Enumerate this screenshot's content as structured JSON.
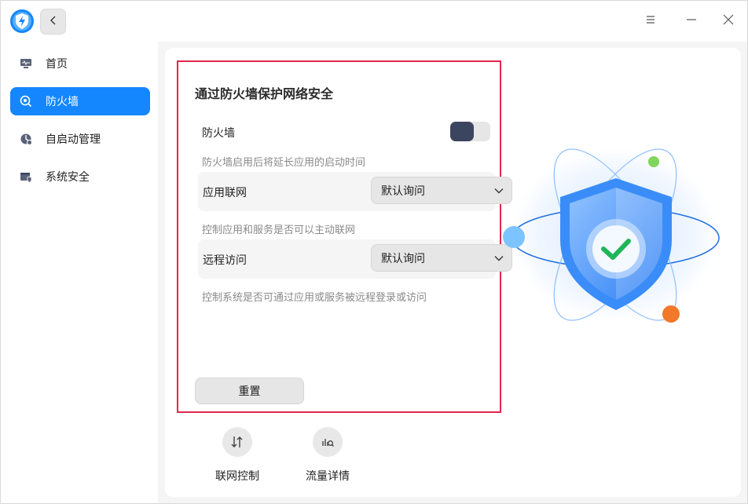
{
  "titlebar": {
    "logo_icon": "shield-lightning-icon",
    "back_icon": "chevron-left-icon",
    "menu_icon": "menu-icon",
    "minimize_icon": "minimize-icon",
    "close_icon": "close-icon"
  },
  "sidebar": {
    "items": [
      {
        "label": "首页",
        "icon": "monitor-icon",
        "active": false
      },
      {
        "label": "防火墙",
        "icon": "firewall-icon",
        "active": true
      },
      {
        "label": "自启动管理",
        "icon": "startup-icon",
        "active": false
      },
      {
        "label": "系统安全",
        "icon": "system-security-icon",
        "active": false
      }
    ]
  },
  "panel": {
    "title": "通过防火墙保护网络安全",
    "firewall_label": "防火墙",
    "firewall_enabled": false,
    "firewall_hint": "防火墙启用后将延长应用的启动时间",
    "app_network_label": "应用联网",
    "app_network_value": "默认询问",
    "app_network_hint": "控制应用和服务是否可以主动联网",
    "remote_access_label": "远程访问",
    "remote_access_value": "默认询问",
    "remote_access_hint": "控制系统是否可通过应用或服务被远程登录或访问",
    "reset_label": "重置"
  },
  "tools": [
    {
      "label": "联网控制",
      "icon": "network-control-icon"
    },
    {
      "label": "流量详情",
      "icon": "traffic-details-icon"
    }
  ],
  "colors": {
    "accent": "#1487ff",
    "highlight_border": "#e3264d",
    "toggle_knob": "#3c4560"
  }
}
